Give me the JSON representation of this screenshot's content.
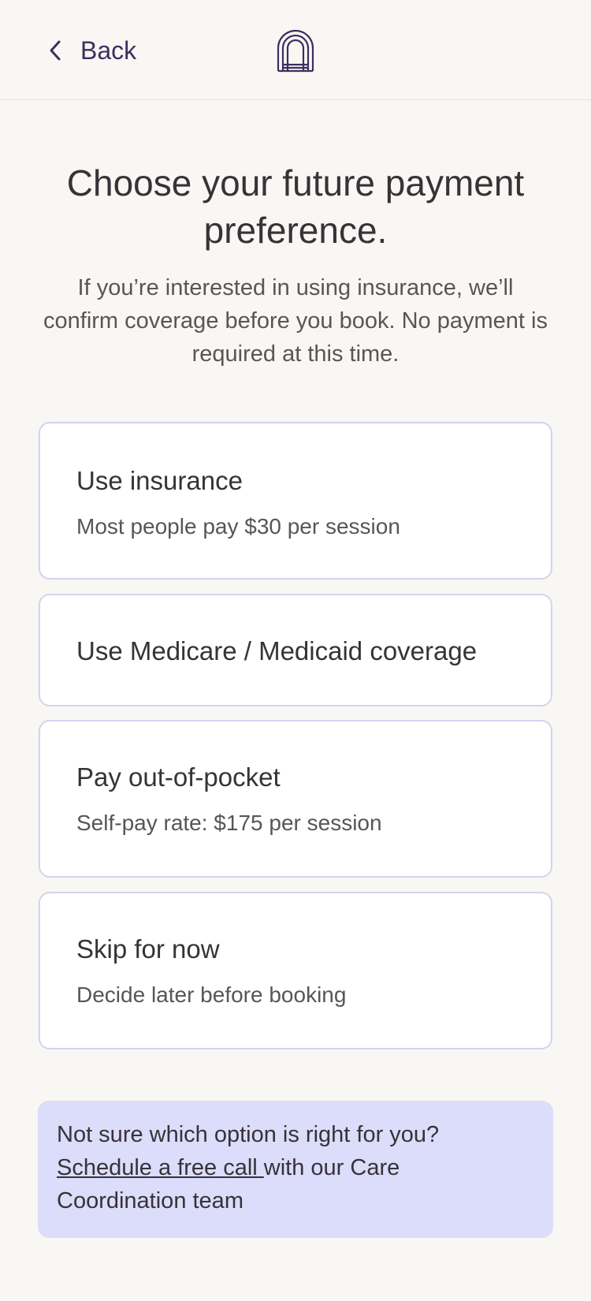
{
  "header": {
    "back_label": "Back",
    "back_icon": "chevron-left-icon",
    "logo_icon": "arch-logo-icon"
  },
  "page": {
    "title": "Choose your future payment preference.",
    "subtitle": "If you’re interested in using insurance, we’ll confirm coverage before you book. No payment is required at this time."
  },
  "options": [
    {
      "title": "Use insurance",
      "description": "Most people pay $30 per session"
    },
    {
      "title": "Use Medicare / Medicaid coverage",
      "description": ""
    },
    {
      "title": "Pay out-of-pocket",
      "description": "Self-pay rate: $175 per session"
    },
    {
      "title": "Skip for now",
      "description": "Decide later before booking"
    }
  ],
  "help": {
    "question": "Not sure which option is right for you?",
    "link_text": "Schedule a free call ",
    "after_link": "with our Care Coordination team"
  },
  "colors": {
    "background": "#f8f7f3",
    "card_border": "#d3d3f1",
    "help_background": "#dcdcfb",
    "brand_purple": "#3a3060"
  }
}
